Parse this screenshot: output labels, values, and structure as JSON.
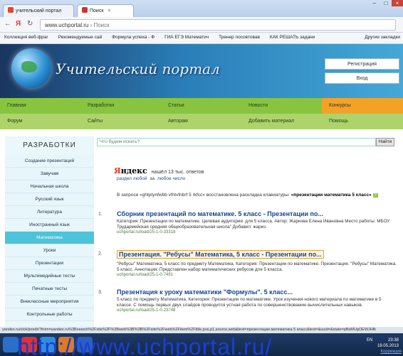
{
  "browser": {
    "tabs": [
      "учительский портал",
      "Поиск"
    ],
    "url": "www.uchportal.ru",
    "url_suffix": "› Поиск",
    "bookmarks": [
      "Коллекция веб-фраг",
      "Рекомендуемые сай",
      "Формула успеха - Ф",
      "ГИА ЕГЭ Математич",
      "Тренер посовтовав",
      "КАК РЕШАТЬ задани"
    ],
    "other_bookmarks": "Другие закладки"
  },
  "site": {
    "title": "Учительский портал",
    "register": "Регистрация",
    "login": "Вход"
  },
  "menu1": [
    "Главная",
    "Разработки",
    "Статьи",
    "Новости",
    "Конкурсы"
  ],
  "menu2": [
    "Форум",
    "Сайты",
    "Авторам",
    "Добавить материал",
    "Помощь"
  ],
  "sidebar": {
    "title": "РАЗРАБОТКИ",
    "items": [
      "Создание презентаций",
      "Завучам",
      "Начальная школа",
      "Русский язык",
      "Литература",
      "Иностранный язык",
      "Математика",
      "Уроки",
      "Презентации",
      "Мультимедийные тесты",
      "Печатные тесты",
      "Внеклассные мероприятия",
      "Контрольные работы"
    ]
  },
  "search": {
    "placeholder": "Что будем искать?",
    "button": "Найти"
  },
  "yandex": {
    "logo_y": "Я",
    "logo_rest": "ндекс",
    "found": "нашёл 13 тыс. ответов",
    "scope_any": "раздел любой",
    "scope_sep": "за",
    "scope_date": "любое число",
    "note_before": "В запросе «ghtptynfwbb vfntvfnbrf 5 rkfcc» восстановлена раскладка клавиатуры: ",
    "note_bold": "«презентации математика 5 класс»",
    "note_q": "?"
  },
  "results": [
    {
      "num": "1.",
      "title": "Сборник презентаций по математике. 5 класс - Презентации по...",
      "text": "Категория: Презентации по математике. Целевая аудитория: для 5 класса. Автор: Жаркова Елена Ивановна Место работы: МБОУ Трудармейская средняя общеобразовательная школа\" Добавил: жарко.",
      "url": "uchportal.ru/load/25-1-0-33318"
    },
    {
      "num": "2.",
      "title": "Презентация. \"Ребусы\" Математика, 5 класс - Презентации по...",
      "text": "\"Ребусы\" Математика, 5 класс по предмету Математика. Категория: Презентации по математике. Презентация. \"Ребусы\" Математика. 5 класс. Аннотация: Представлен набор математических ребусов для 5 класса.",
      "url": "uchportal.ru/load/25-1-0-7491"
    },
    {
      "num": "3.",
      "title": "Презентация к уроку математики \"Формулы\". 5 класс...",
      "text": "5 класс по предмету Математика. Категория: Презентации по математике. Урок изучения нового материала по математике в 5 классе. С помощь первых двух слайдов проводится устная работа по совершенствованию вычислительных навыков.",
      "url": "uchportal.ru/load/25-1-0-23748"
    }
  ],
  "status": "yandex.ru/clck/jsredir?from=yandex.ru%3Bsearch%2Fsite%2F%3Bweb%3B%3B%2Fsite%2Fweb%2Fitem%2Ftitle,pos,p1,source,web&text=презентации математика 5 класс&text=&uuid=&state=pBsMUgOEWJHfk",
  "taskbar": {
    "clock": "23:38",
    "date": "18.05.2013",
    "lang": "EN"
  },
  "overlay_url": "http://www.uchportal.ru/",
  "correction": "Коррекция"
}
